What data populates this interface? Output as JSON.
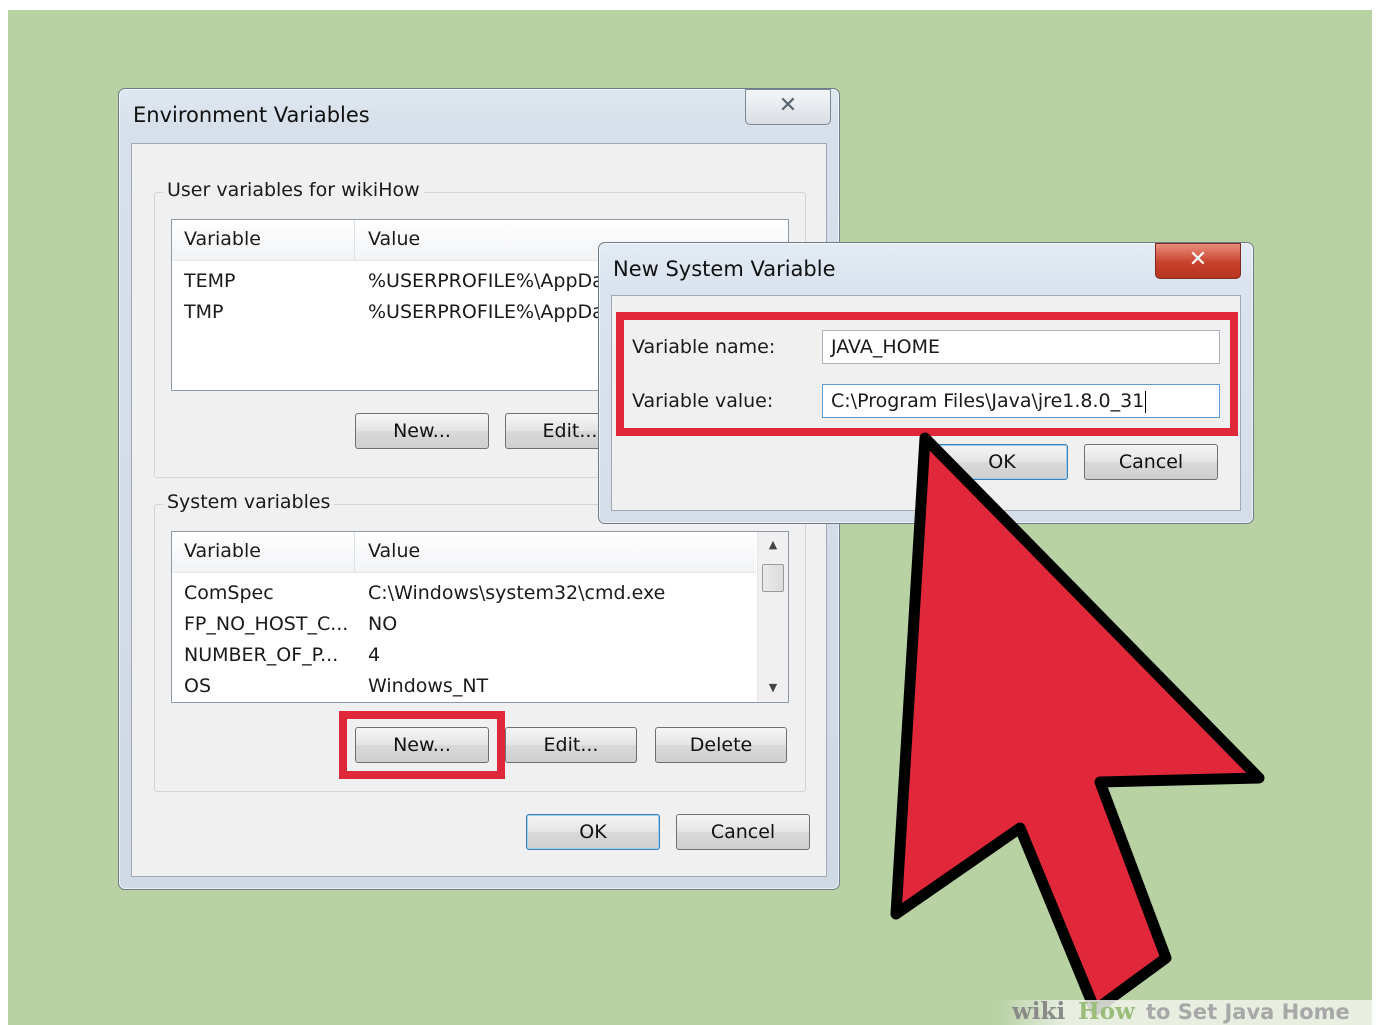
{
  "env_dialog": {
    "title": "Environment Variables",
    "close_glyph": "✕",
    "user_group": {
      "label": "User variables for wikiHow",
      "columns": [
        "Variable",
        "Value"
      ],
      "rows": [
        {
          "variable": "TEMP",
          "value": "%USERPROFILE%\\AppDa"
        },
        {
          "variable": "TMP",
          "value": "%USERPROFILE%\\AppDa"
        }
      ],
      "new_label": "New...",
      "edit_label": "Edit..."
    },
    "system_group": {
      "label": "System variables",
      "columns": [
        "Variable",
        "Value"
      ],
      "rows": [
        {
          "variable": "ComSpec",
          "value": "C:\\Windows\\system32\\cmd.exe"
        },
        {
          "variable": "FP_NO_HOST_C...",
          "value": "NO"
        },
        {
          "variable": "NUMBER_OF_P...",
          "value": "4"
        },
        {
          "variable": "OS",
          "value": "Windows_NT"
        }
      ],
      "new_label": "New...",
      "edit_label": "Edit...",
      "delete_label": "Delete"
    },
    "ok_label": "OK",
    "cancel_label": "Cancel"
  },
  "new_var_dialog": {
    "title": "New System Variable",
    "close_glyph": "✕",
    "name_label": "Variable name:",
    "name_value": "JAVA_HOME",
    "value_label": "Variable value:",
    "value_value": "C:\\Program Files\\Java\\jre1.8.0_31",
    "ok_label": "OK",
    "cancel_label": "Cancel"
  },
  "watermark": {
    "wiki": "wiki",
    "how": "How",
    "rest": "to Set Java Home"
  },
  "colors": {
    "background": "#b8d2a4",
    "highlight": "#e0283a",
    "cursor": "#e0283a"
  }
}
